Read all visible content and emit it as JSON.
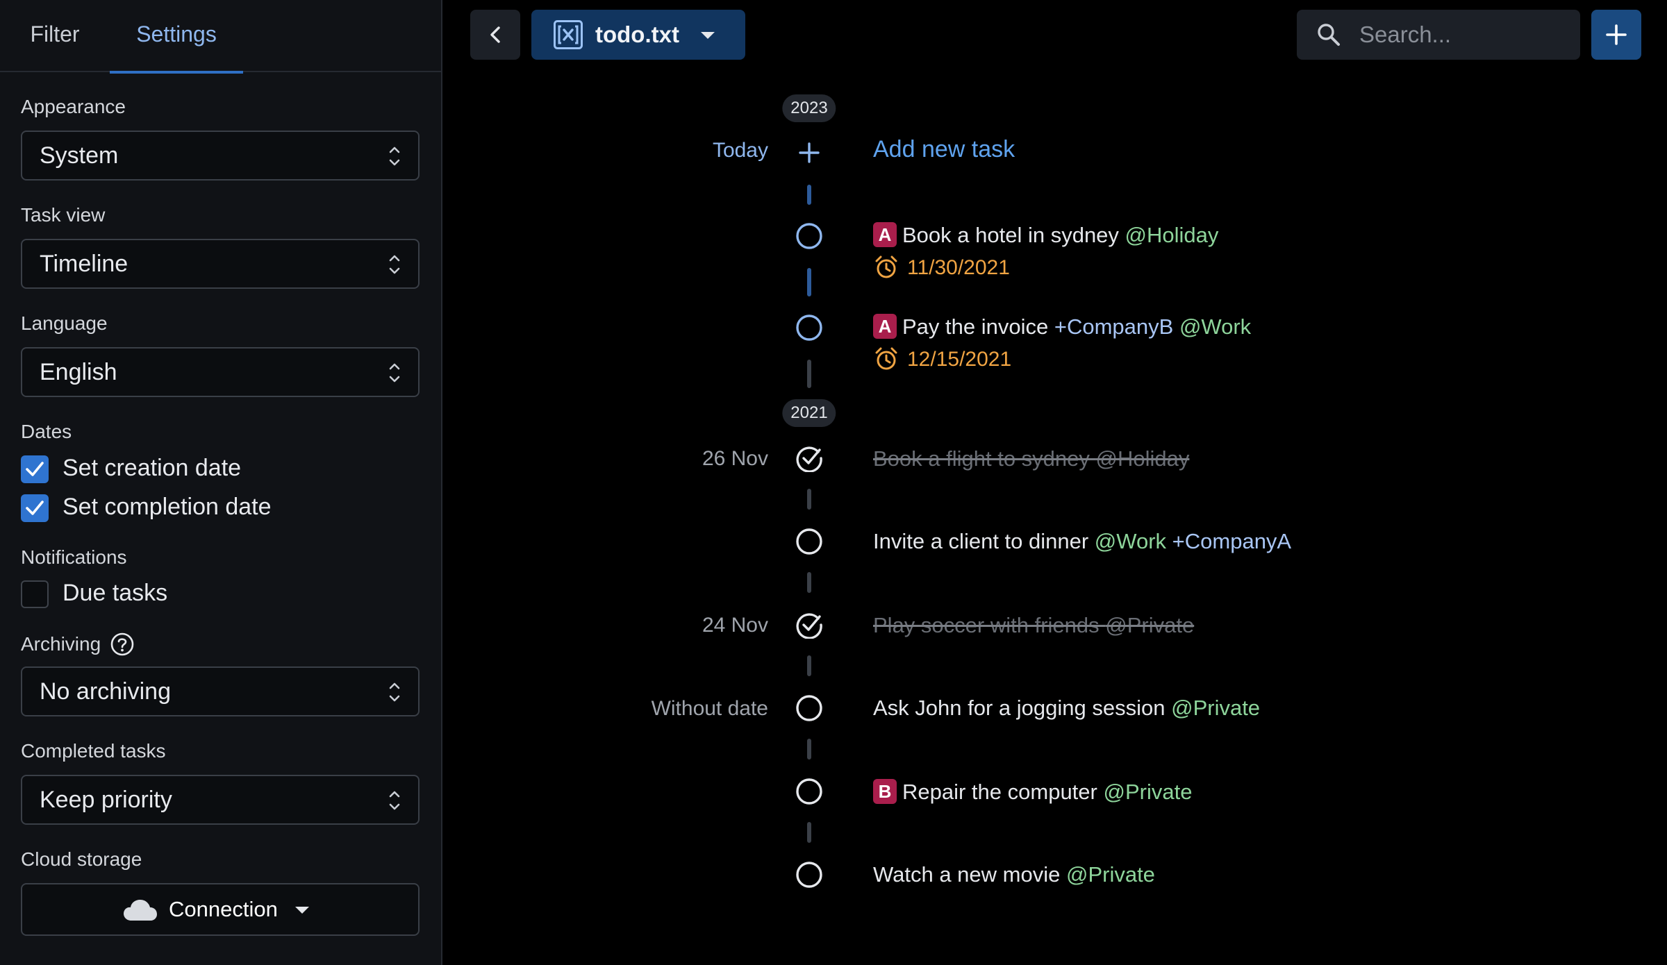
{
  "sidebar": {
    "tabs": [
      {
        "label": "Filter",
        "active": false
      },
      {
        "label": "Settings",
        "active": true
      }
    ],
    "appearance": {
      "label": "Appearance",
      "value": "System"
    },
    "task_view": {
      "label": "Task view",
      "value": "Timeline"
    },
    "language": {
      "label": "Language",
      "value": "English"
    },
    "dates": {
      "label": "Dates",
      "creation": {
        "label": "Set creation date",
        "checked": true
      },
      "completion": {
        "label": "Set completion date",
        "checked": true
      }
    },
    "notifications": {
      "label": "Notifications",
      "due": {
        "label": "Due tasks",
        "checked": false
      }
    },
    "archiving": {
      "label": "Archiving",
      "value": "No archiving",
      "help_icon": "question-circle-icon"
    },
    "completed_tasks": {
      "label": "Completed tasks",
      "value": "Keep priority"
    },
    "cloud_storage": {
      "label": "Cloud storage",
      "button": "Connection",
      "icon": "cloud-icon"
    }
  },
  "topbar": {
    "file_name": "todo.txt",
    "search_placeholder": "Search..."
  },
  "timeline": {
    "year_2023": "2023",
    "year_2021": "2021",
    "today_label": "Today",
    "add_task": "Add new task",
    "date_26nov": "26 Nov",
    "date_24nov": "24 Nov",
    "without_date": "Without date",
    "tasks": [
      {
        "priority": "A",
        "text": "Book a hotel in sydney ",
        "tags": [
          "@Holiday"
        ],
        "due": "11/30/2021",
        "done": false
      },
      {
        "priority": "A",
        "text": "Pay the invoice ",
        "tags": [
          "+CompanyB",
          "@Work"
        ],
        "due": "12/15/2021",
        "done": false
      },
      {
        "priority": "",
        "text": "Book a flight to sydney ",
        "tags": [
          "@Holiday"
        ],
        "due": "",
        "done": true
      },
      {
        "priority": "",
        "text": "Invite a client to dinner ",
        "tags": [
          "@Work",
          "+CompanyA"
        ],
        "due": "",
        "done": false
      },
      {
        "priority": "",
        "text": "Play soccer with friends ",
        "tags": [
          "@Private"
        ],
        "due": "",
        "done": true
      },
      {
        "priority": "",
        "text": "Ask John for a jogging session ",
        "tags": [
          "@Private"
        ],
        "due": "",
        "done": false
      },
      {
        "priority": "B",
        "text": "Repair the computer ",
        "tags": [
          "@Private"
        ],
        "due": "",
        "done": false
      },
      {
        "priority": "",
        "text": "Watch a new movie ",
        "tags": [
          "@Private"
        ],
        "due": "",
        "done": false
      }
    ]
  },
  "colors": {
    "accent": "#2f74d0",
    "context_tag": "#8ed59b",
    "project_tag": "#a9c6f5",
    "due_date": "#f0a443",
    "priority_badge": "#a91e4c"
  }
}
